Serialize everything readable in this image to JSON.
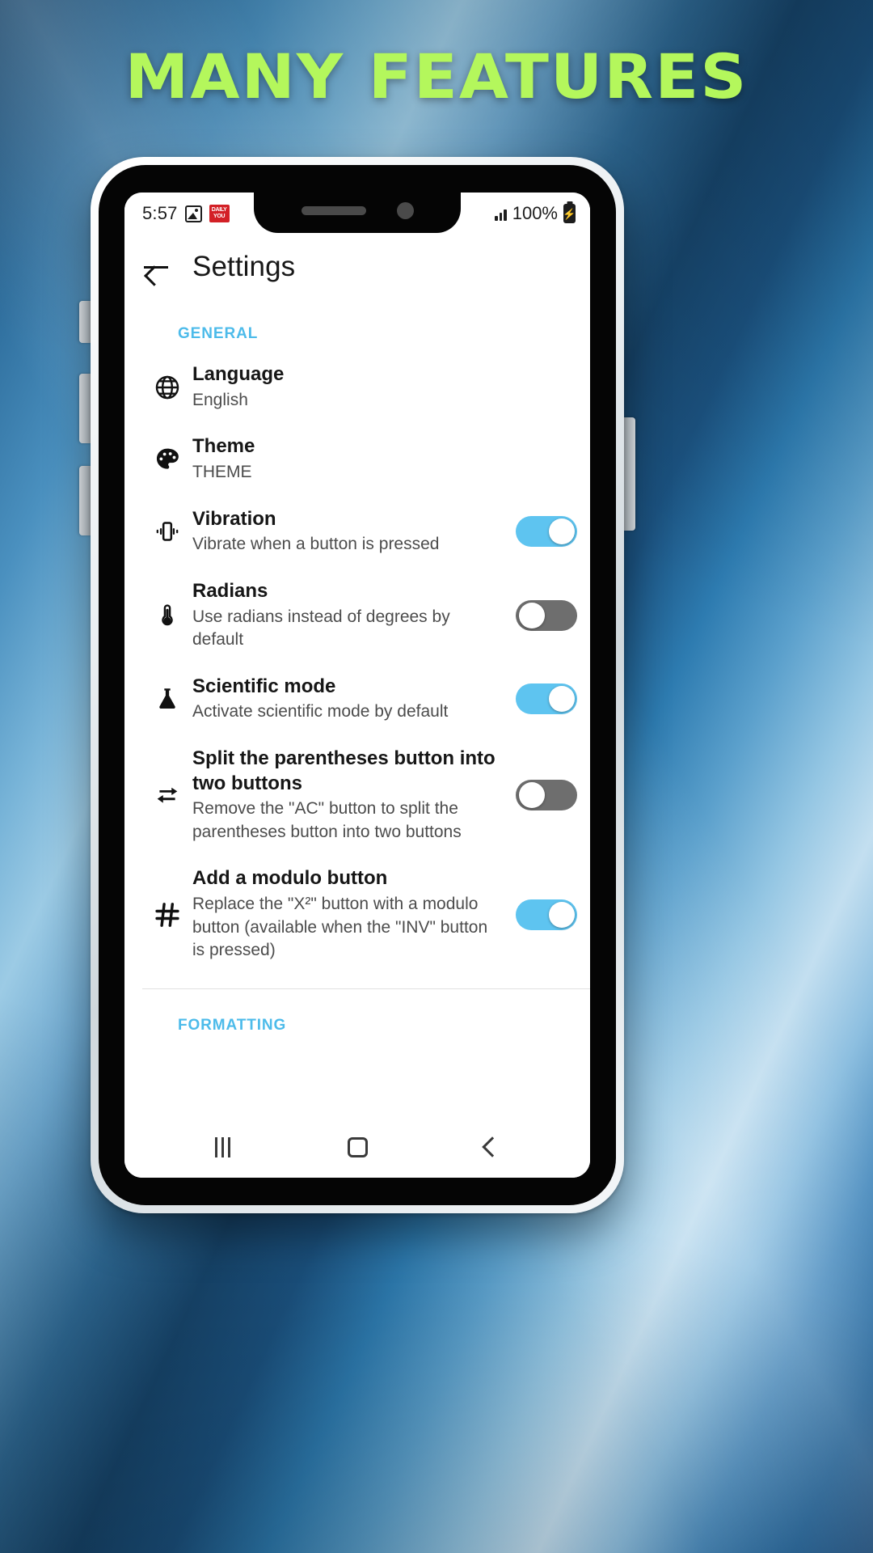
{
  "headline": "MANY FEATURES",
  "colors": {
    "headline": "#b4f75c",
    "section_accent": "#4dbbea",
    "toggle_on": "#5ec4f0",
    "toggle_off": "#6e6e6e",
    "badge_red": "#d32026"
  },
  "status_bar": {
    "time": "5:57",
    "icons": [
      "photo-icon",
      "news-badge-icon",
      "signal-icon"
    ],
    "badge_line1": "DAILY",
    "badge_line2": "YOU",
    "battery_text": "100%",
    "battery_icon": "battery-charging-icon"
  },
  "appbar": {
    "back_icon": "back-arrow-icon",
    "title": "Settings"
  },
  "sections": [
    {
      "header": "GENERAL",
      "rows": [
        {
          "icon": "globe-icon",
          "title": "Language",
          "subtitle": "English",
          "control": "none"
        },
        {
          "icon": "palette-icon",
          "title": "Theme",
          "subtitle": "THEME",
          "control": "none"
        },
        {
          "icon": "vibration-icon",
          "title": "Vibration",
          "subtitle": "Vibrate when a button is pressed",
          "control": "toggle",
          "value": "on"
        },
        {
          "icon": "thermometer-icon",
          "title": "Radians",
          "subtitle": "Use radians instead of degrees by default",
          "control": "toggle",
          "value": "off"
        },
        {
          "icon": "flask-icon",
          "title": "Scientific mode",
          "subtitle": "Activate scientific mode by default",
          "control": "toggle",
          "value": "on"
        },
        {
          "icon": "swap-arrows-icon",
          "title": "Split the parentheses button into two buttons",
          "subtitle": "Remove the \"AC\" button to split the parentheses button into two buttons",
          "control": "toggle",
          "value": "off"
        },
        {
          "icon": "hash-icon",
          "title": "Add a modulo button",
          "subtitle": "Replace the \"X²\" button with a modulo button (available when the \"INV\" button is pressed)",
          "control": "toggle",
          "value": "on"
        }
      ]
    },
    {
      "header": "FORMATTING",
      "rows": []
    }
  ],
  "navbar": {
    "recents": "recents-icon",
    "home": "home-icon",
    "back": "nav-back-icon"
  }
}
